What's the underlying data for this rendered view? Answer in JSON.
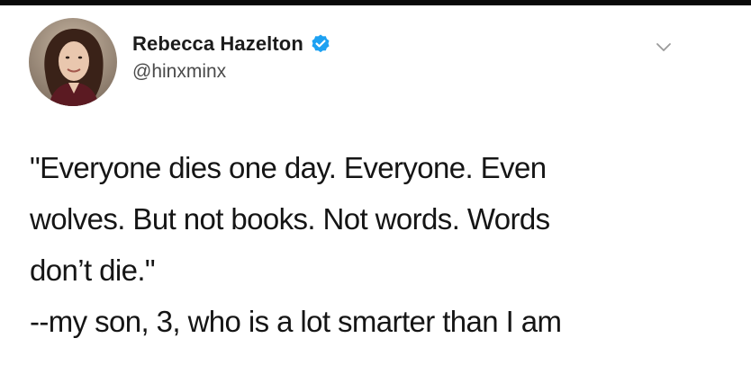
{
  "tweet": {
    "author": {
      "display_name": "Rebecca Hazelton",
      "handle": "@hinxminx",
      "verified": true,
      "avatar_icon": "user-avatar"
    },
    "menu_icon": "chevron-down-icon",
    "text_lines": [
      "\"Everyone dies one day. Everyone. Even",
      "wolves. But not books. Not words. Words",
      "don’t die.\"",
      "--my son, 3, who is a lot smarter than I am"
    ]
  },
  "colors": {
    "verified_badge": "#1da1f2",
    "text": "#151515",
    "handle": "#4a4a4a",
    "top_bar": "#0a0a0a"
  }
}
